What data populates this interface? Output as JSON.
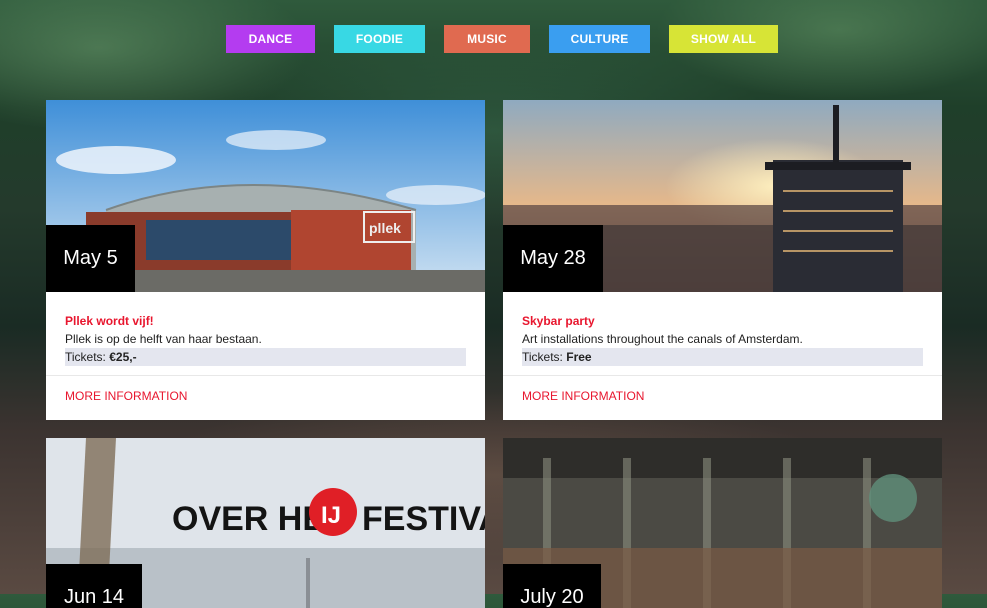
{
  "filters": [
    {
      "label": "DANCE",
      "color": "#b43cf0"
    },
    {
      "label": "FOODIE",
      "color": "#38d8e4"
    },
    {
      "label": "MUSIC",
      "color": "#e06a50"
    },
    {
      "label": "CULTURE",
      "color": "#3a9ef0"
    },
    {
      "label": "SHOW ALL",
      "color": "#d7e436"
    }
  ],
  "cards": [
    {
      "date": "May 5",
      "title": "Pllek wordt vijf!",
      "description": "Pllek is op de helft van haar bestaan.",
      "tickets_label": "Tickets:",
      "tickets_value": "€25,-",
      "more_label": "MORE INFORMATION",
      "image_sign": "pllek"
    },
    {
      "date": "May 28",
      "title": "Skybar party",
      "description": "Art installations throughout the canals of Amsterdam.",
      "tickets_label": "Tickets:",
      "tickets_value": "Free",
      "more_label": "MORE INFORMATION"
    },
    {
      "date": "Jun 14",
      "image_text_left": "OVER HET",
      "image_logo": "IJ",
      "image_text_right": "FESTIVAL"
    },
    {
      "date": "July 20"
    }
  ],
  "colors": {
    "accent_red": "#e8162e",
    "ticket_bg": "#e4e6ef",
    "badge_bg": "#000000"
  }
}
